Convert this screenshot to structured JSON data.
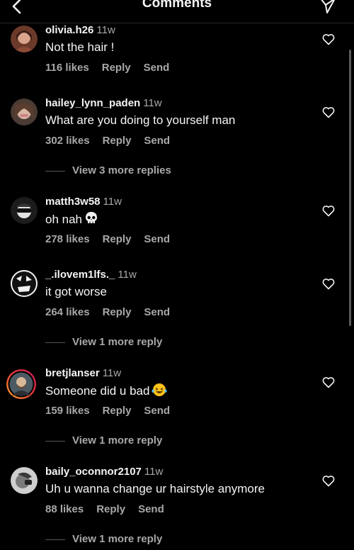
{
  "header": {
    "title": "Comments"
  },
  "comments": [
    {
      "username": "olivia.h26",
      "time": "11w",
      "text": "Not the hair !",
      "likes": "116 likes",
      "reply": "Reply",
      "send": "Send"
    },
    {
      "username": "hailey_lynn_paden",
      "time": "11w",
      "text": "What are you doing to yourself man",
      "likes": "302 likes",
      "reply": "Reply",
      "send": "Send",
      "view_more": "View 3 more replies"
    },
    {
      "username": "matth3w58",
      "time": "11w",
      "text": "oh nah",
      "emoji": "skull-emoji",
      "likes": "278 likes",
      "reply": "Reply",
      "send": "Send"
    },
    {
      "username": "_.ilovem1lfs._",
      "time": "11w",
      "text": "it got worse",
      "likes": "264 likes",
      "reply": "Reply",
      "send": "Send",
      "view_more": "View 1 more reply"
    },
    {
      "username": "bretjlanser",
      "time": "11w",
      "text": "Someone did u bad",
      "emoji": "laughing-tears-emoji",
      "likes": "159 likes",
      "reply": "Reply",
      "send": "Send",
      "view_more": "View 1 more reply"
    },
    {
      "username": "baily_oconnor2107",
      "time": "11w",
      "text": "Uh u wanna change ur hairstyle anymore",
      "likes": "88 likes",
      "reply": "Reply",
      "send": "Send",
      "view_more": "View 1 more reply"
    }
  ],
  "colors": {
    "background": "#000000",
    "text": "#f5f5f5",
    "muted": "#a8a8a8",
    "divider": "#262626"
  },
  "icons": [
    "back-chevron-icon",
    "share-send-icon",
    "heart-icon"
  ]
}
